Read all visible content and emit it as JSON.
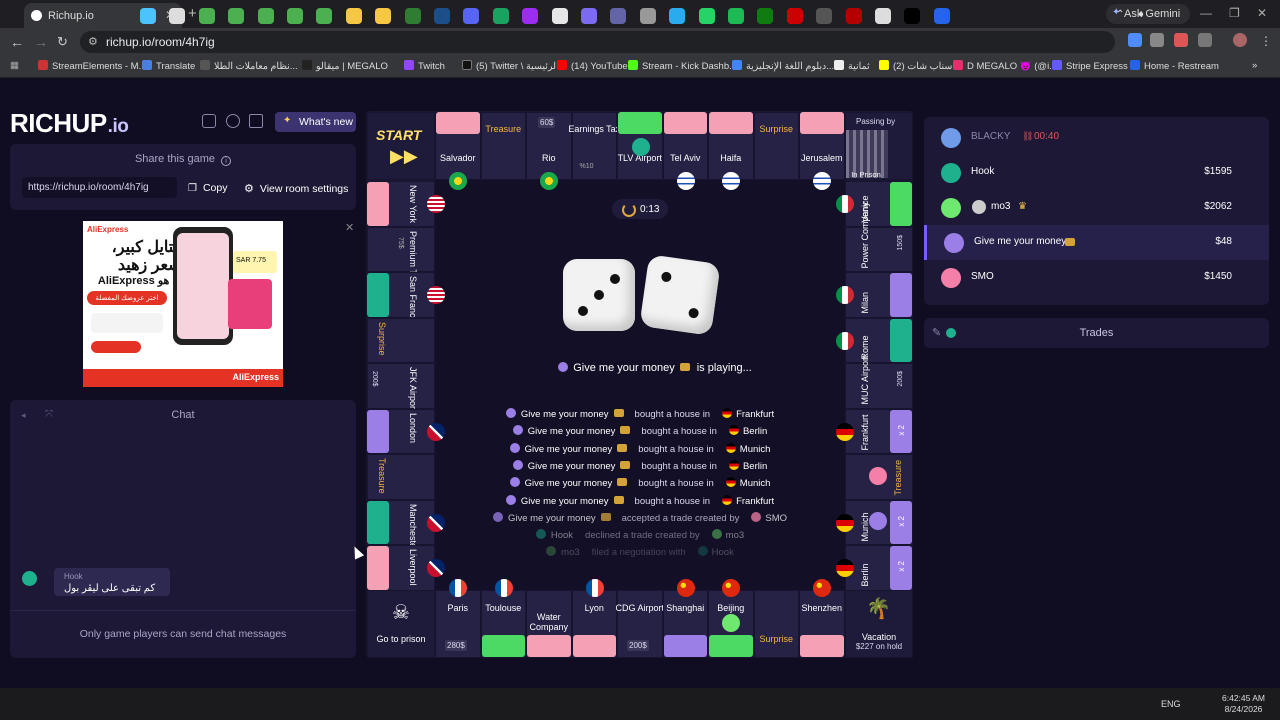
{
  "browser": {
    "tab_title": "Richup.io",
    "url": "richup.io/room/4h7ig",
    "ask_gemini": "Ask Gemini",
    "bookmarks": [
      "StreamElements - M...",
      "Translate",
      "نظام معاملات الطلا...",
      "ميقالو | MEGALO",
      "Twitch",
      "(5) Twitter \\ الرئيسية",
      "(14) YouTube",
      "Stream - Kick Dashb...",
      "دبلوم اللغة الإنجليزية...",
      "ثمانية",
      "(2) سناب شات",
      "D MEGALO 😈 (@i...",
      "Stripe Express",
      "Home - Restream"
    ]
  },
  "header": {
    "logo_main": "RICHUP",
    "logo_suffix": ".io",
    "whats_new": "What's new"
  },
  "share": {
    "title": "Share this game",
    "url": "https://richup.io/room/4h7ig",
    "copy": "Copy",
    "room_settings": "View room settings"
  },
  "ad": {
    "brand": "AliExpress",
    "headline1": "ستايل كبير،",
    "headline2": "بسعر زهيد",
    "sub": "هذا هو AliExpress",
    "cta": "اختر عروضك المفضلة",
    "price": "SAR 7.75"
  },
  "chat": {
    "title": "Chat",
    "msg_author": "Hook",
    "msg_text": "كم تبقى على ليڤر بول",
    "note": "Only game players can send chat messages"
  },
  "board": {
    "start": "START",
    "passing_by": "Passing by",
    "in_prison": "In Prison",
    "go_to_prison": "Go to prison",
    "vacation": "Vacation",
    "vacation_amount": "$227 on hold",
    "top": [
      {
        "name": "Salvador",
        "flag": "BR",
        "strip": "#f4a0b5"
      },
      {
        "name": "Treasure",
        "strip": ""
      },
      {
        "name": "Rio",
        "flag": "BR",
        "price": "60$",
        "strip": ""
      },
      {
        "name": "Earnings Tax",
        "sub": "%10",
        "strip": ""
      },
      {
        "name": "TLV Airport",
        "strip": "#4cd964"
      },
      {
        "name": "Tel Aviv",
        "flag": "IL",
        "strip": "#f4a0b5"
      },
      {
        "name": "Haifa",
        "flag": "IL",
        "strip": "#f4a0b5"
      },
      {
        "name": "Surprise",
        "strip": ""
      },
      {
        "name": "Jerusalem",
        "flag": "IL",
        "strip": "#f4a0b5"
      }
    ],
    "left": [
      {
        "name": "New York",
        "flag": "US",
        "strip": "#f4a0b5"
      },
      {
        "name": "Premium Tax",
        "sub": "75$"
      },
      {
        "name": "San Francisco",
        "flag": "US",
        "strip": "#1fb08e"
      },
      {
        "name": "Surprise"
      },
      {
        "name": "JFK Airport",
        "price": "200$"
      },
      {
        "name": "London",
        "flag": "GB",
        "strip": "#9b7fe6"
      },
      {
        "name": "Treasure"
      },
      {
        "name": "Manchester",
        "flag": "GB",
        "strip": "#1fb08e"
      },
      {
        "name": "Liverpool",
        "flag": "GB",
        "strip": "#f4a0b5"
      }
    ],
    "right": [
      {
        "name": "Venice",
        "flag": "IT",
        "strip": "#4cd964"
      },
      {
        "name": "Power Company",
        "price": "150$"
      },
      {
        "name": "Milan",
        "flag": "IT",
        "strip": "#9b7fe6"
      },
      {
        "name": "Rome",
        "flag": "IT",
        "strip": "#1fb08e"
      },
      {
        "name": "MUC Airport",
        "price": "200$"
      },
      {
        "name": "Frankfurt",
        "flag": "DE",
        "houses": "x 2",
        "strip": "#9b7fe6"
      },
      {
        "name": "Treasure"
      },
      {
        "name": "Munich",
        "flag": "DE",
        "houses": "x 2",
        "strip": "#9b7fe6"
      },
      {
        "name": "Berlin",
        "flag": "DE",
        "houses": "x 2",
        "strip": "#9b7fe6"
      }
    ],
    "bottom": [
      {
        "name": "Paris",
        "flag": "FR",
        "price": "280$"
      },
      {
        "name": "Toulouse",
        "flag": "FR",
        "strip": "#4cd964"
      },
      {
        "name": "Water Company",
        "strip": "#f4a0b5"
      },
      {
        "name": "Lyon",
        "flag": "FR",
        "strip": "#f4a0b5"
      },
      {
        "name": "CDG Airport",
        "price": "200$"
      },
      {
        "name": "Shanghai",
        "flag": "CN",
        "strip": "#9b7fe6"
      },
      {
        "name": "Beijing",
        "flag": "CN",
        "strip": "#4cd964"
      },
      {
        "name": "Surprise"
      },
      {
        "name": "Shenzhen",
        "flag": "CN",
        "strip": "#f4a0b5"
      }
    ],
    "timer": "0:13",
    "dice": [
      3,
      2
    ],
    "playing_player": "Give me your money",
    "playing_suffix": "is playing..."
  },
  "log": [
    {
      "who": "Give me your money",
      "action": "bought a house in",
      "city": "Frankfurt",
      "flag": "DE"
    },
    {
      "who": "Give me your money",
      "action": "bought a house in",
      "city": "Berlin",
      "flag": "DE"
    },
    {
      "who": "Give me your money",
      "action": "bought a house in",
      "city": "Munich",
      "flag": "DE"
    },
    {
      "who": "Give me your money",
      "action": "bought a house in",
      "city": "Berlin",
      "flag": "DE"
    },
    {
      "who": "Give me your money",
      "action": "bought a house in",
      "city": "Munich",
      "flag": "DE"
    },
    {
      "who": "Give me your money",
      "action": "bought a house in",
      "city": "Frankfurt",
      "flag": "DE"
    },
    {
      "who": "Give me your money",
      "action": "accepted a trade created by",
      "city": "SMO"
    },
    {
      "who": "Hook",
      "action": "declined a trade created by",
      "city": "mo3"
    },
    {
      "who": "mo3",
      "action": "filed a negotiation with",
      "city": "Hook"
    }
  ],
  "players": [
    {
      "name": "BLACKY",
      "money": "",
      "timer": "00:40",
      "color": "#6f9be8"
    },
    {
      "name": "Hook",
      "money": "$1595",
      "color": "#1fb08e"
    },
    {
      "name": "mo3",
      "money": "$2062",
      "color": "#6fe86f"
    },
    {
      "name": "Give me your money",
      "money": "$48",
      "color": "#9b7fe6"
    },
    {
      "name": "SMO",
      "money": "$1450",
      "color": "#f47fa8"
    }
  ],
  "trades": {
    "title": "Trades"
  },
  "taskbar": {
    "lang": "ENG",
    "time": "6:42:45 AM",
    "date": "8/24/2026"
  },
  "colors": {
    "accent": "#7a5cff",
    "panel": "#1c1836",
    "board": "#1a1731"
  }
}
